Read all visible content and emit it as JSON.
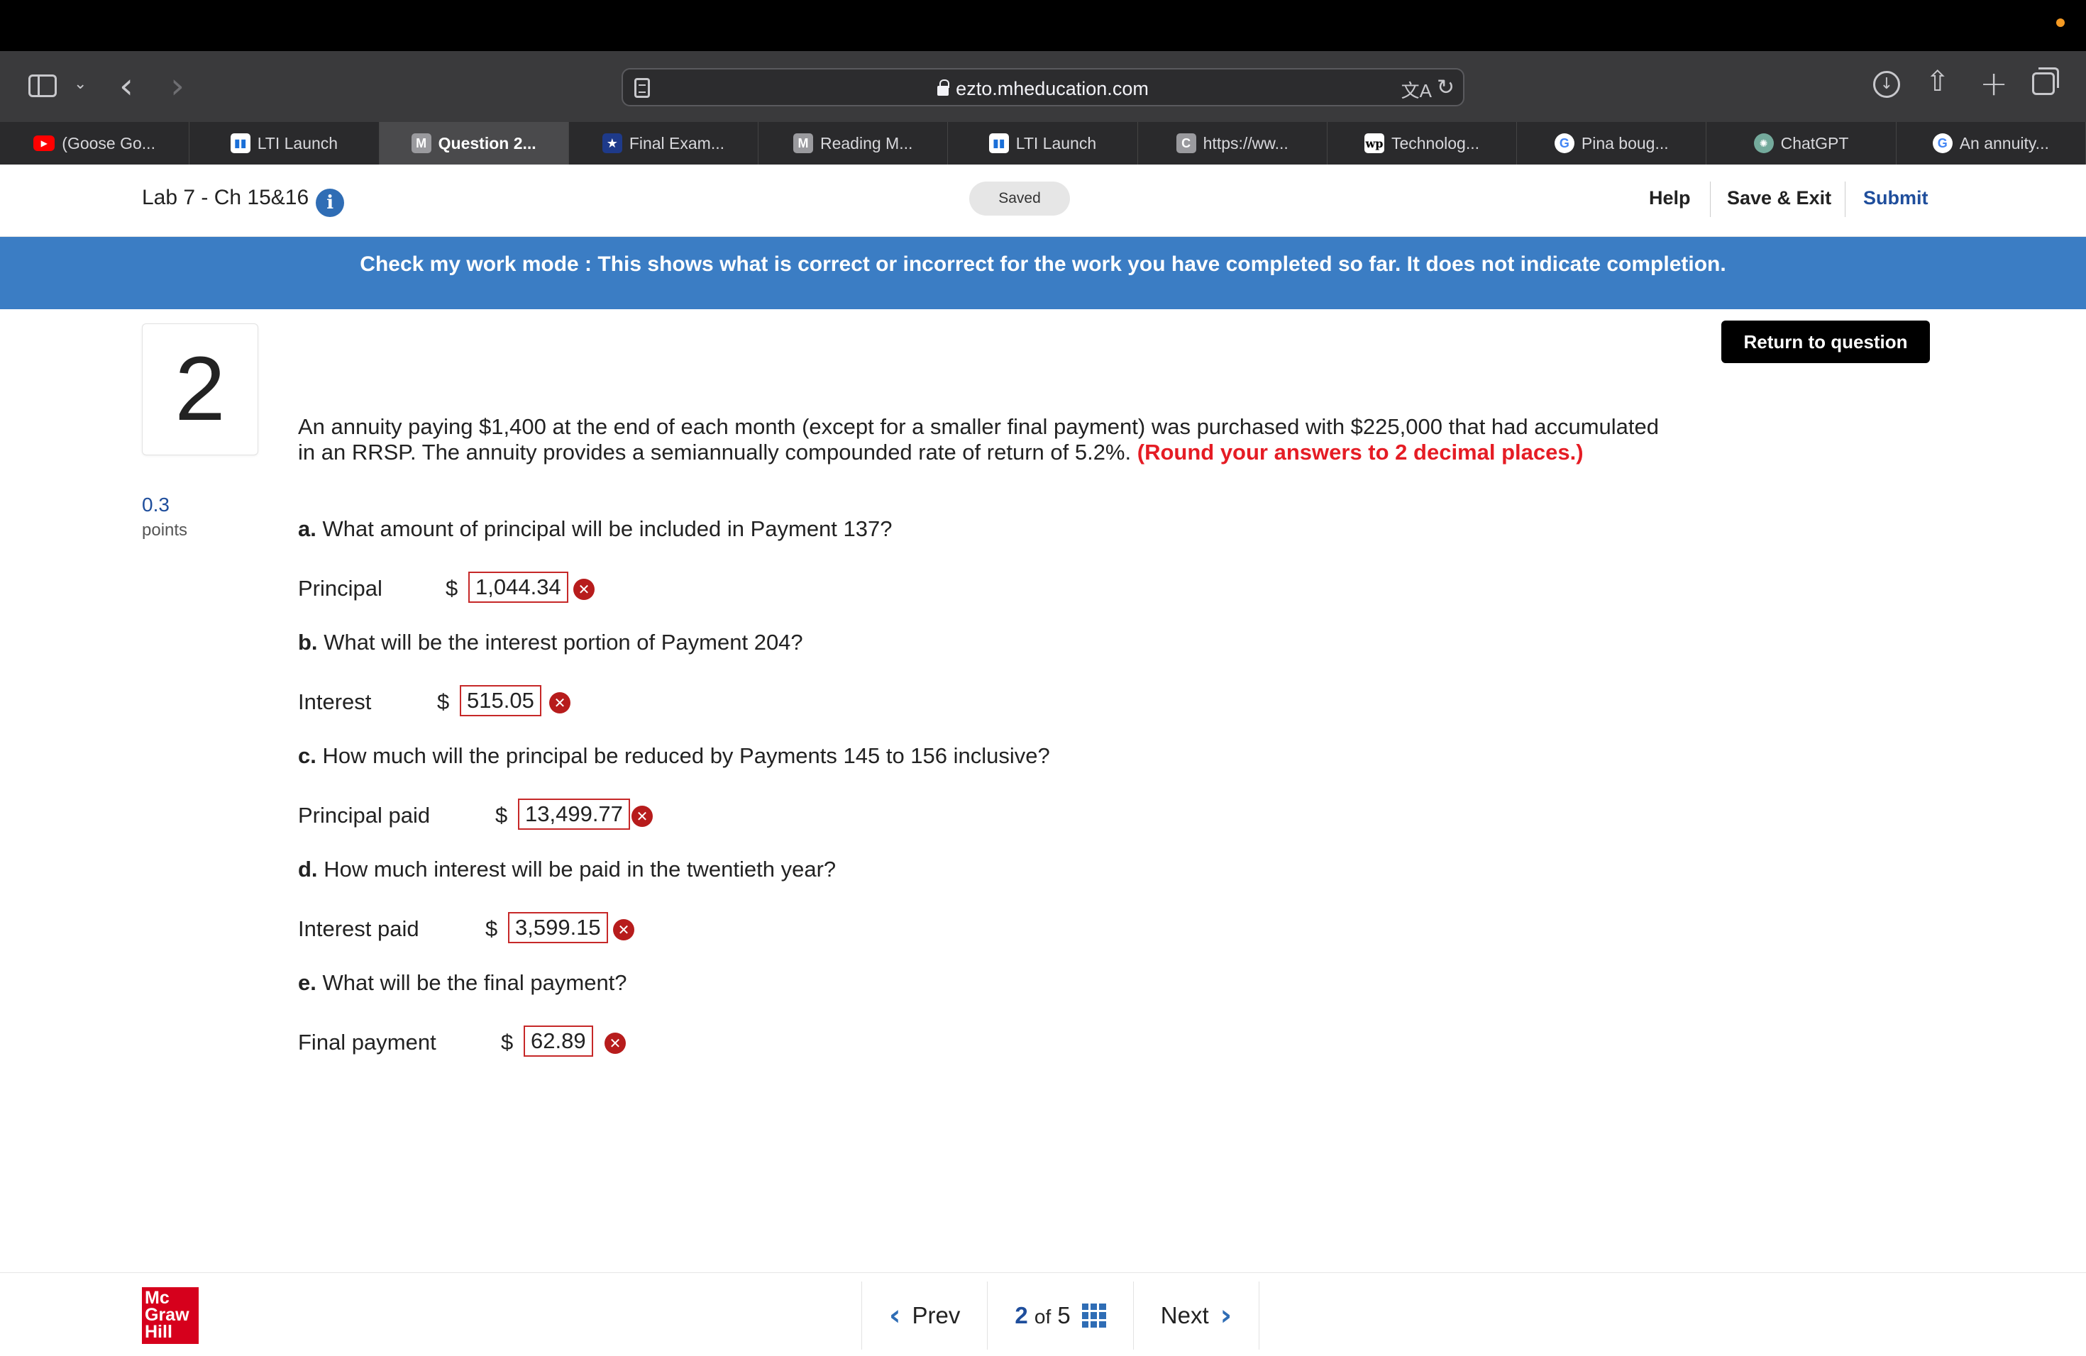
{
  "browser": {
    "url": "ezto.mheducation.com",
    "tabs": [
      {
        "label": "(Goose Go...",
        "favicon": "youtube-icon",
        "active": false
      },
      {
        "label": "LTI Launch",
        "favicon": "chart-icon",
        "active": false
      },
      {
        "label": "Question 2...",
        "favicon": "m-icon",
        "active": true
      },
      {
        "label": "Final Exam...",
        "favicon": "star-icon",
        "active": false
      },
      {
        "label": "Reading M...",
        "favicon": "m-icon",
        "active": false
      },
      {
        "label": "LTI Launch",
        "favicon": "chart-icon",
        "active": false
      },
      {
        "label": "https://ww...",
        "favicon": "c-icon",
        "active": false
      },
      {
        "label": "Technolog...",
        "favicon": "wp-icon",
        "active": false
      },
      {
        "label": "Pina boug...",
        "favicon": "google-icon",
        "active": false
      },
      {
        "label": "ChatGPT",
        "favicon": "chatgpt-icon",
        "active": false
      },
      {
        "label": "An annuity...",
        "favicon": "google-icon",
        "active": false
      }
    ]
  },
  "header": {
    "title": "Lab 7 - Ch 15&16",
    "saved": "Saved",
    "help": "Help",
    "save_exit": "Save & Exit",
    "submit": "Submit"
  },
  "banner": {
    "text": "Check my work mode : This shows what is correct or incorrect for the work you have completed so far. It does not indicate completion."
  },
  "question": {
    "number": "2",
    "points": "0.3",
    "points_label": "points",
    "return_button": "Return to question",
    "stem": "An annuity paying $1,400 at the end of each month (except for a smaller final payment) was purchased with $225,000 that had accumulated in an RRSP. The annuity provides a semiannually compounded rate of return of 5.2%.",
    "round_note": "(Round your answers to 2 decimal places.)",
    "currency": "$",
    "parts": [
      {
        "letter": "a.",
        "question": "What amount of principal will be included in Payment 137?",
        "label": "Principal",
        "answer": "1,044.34",
        "status": "incorrect"
      },
      {
        "letter": "b.",
        "question": "What will be the interest portion of Payment 204?",
        "label": "Interest",
        "answer": "515.05",
        "status": "incorrect"
      },
      {
        "letter": "c.",
        "question": "How much will the principal be reduced by Payments 145 to 156 inclusive?",
        "label": "Principal paid",
        "answer": "13,499.77",
        "status": "incorrect"
      },
      {
        "letter": "d.",
        "question": "How much interest will be paid in the twentieth year?",
        "label": "Interest paid",
        "answer": "3,599.15",
        "status": "incorrect"
      },
      {
        "letter": "e.",
        "question": "What will be the final payment?",
        "label": "Final payment",
        "answer": "62.89",
        "status": "incorrect"
      }
    ]
  },
  "footer": {
    "logo": [
      "Mc",
      "Graw",
      "Hill"
    ],
    "prev": "Prev",
    "next": "Next",
    "current_page": "2",
    "of": "of",
    "total_pages": "5"
  },
  "colors": {
    "banner": "#3b7dc4",
    "error": "#b71c1c",
    "round_note": "#e51c24",
    "submit": "#1f4e9c",
    "logo": "#d6001c"
  }
}
